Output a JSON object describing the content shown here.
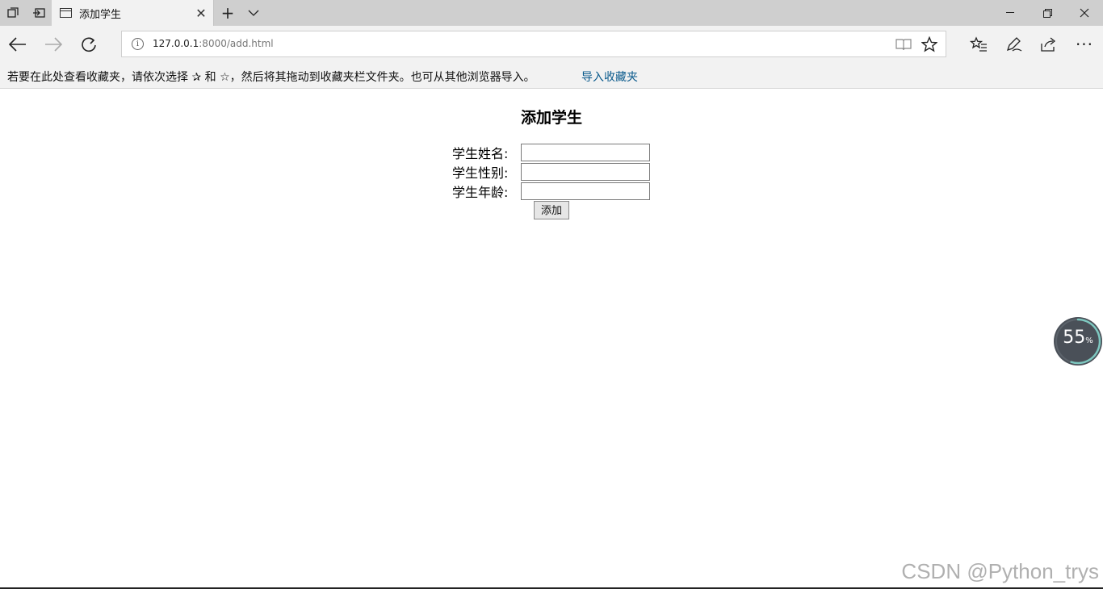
{
  "browser": {
    "tab": {
      "title": "添加学生"
    },
    "address_bar": {
      "url_host": "127.0.0.1",
      "url_rest": ":8000/add.html"
    },
    "favorites_bar": {
      "hint_text": "若要在此处查看收藏夹，请依次选择 ✰ 和 ☆，然后将其拖动到收藏夹栏文件夹。也可从其他浏览器导入。",
      "import_link": "导入收藏夹"
    }
  },
  "page": {
    "title": "添加学生",
    "form": {
      "fields": [
        {
          "label": "学生姓名:",
          "value": ""
        },
        {
          "label": "学生性别:",
          "value": ""
        },
        {
          "label": "学生年龄:",
          "value": ""
        }
      ],
      "submit_label": "添加"
    }
  },
  "overlay": {
    "gauge": {
      "value": "55",
      "unit": "%",
      "percent": 55
    },
    "watermark": "CSDN @Python_trys"
  },
  "colors": {
    "chrome": "#f2f2f2",
    "tabstrip": "#cfcfcf",
    "link": "#0a5a8c",
    "gauge_bg": "#4a5058",
    "gauge_arc": "#7ec8c0"
  }
}
